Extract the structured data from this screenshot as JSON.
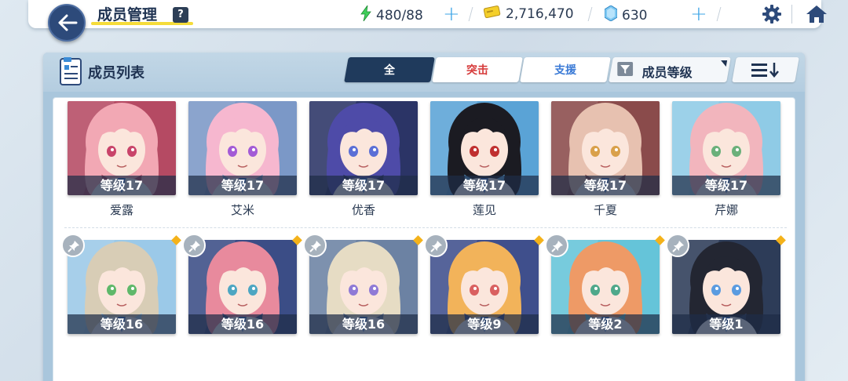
{
  "header": {
    "title": "成员管理",
    "help": "?",
    "stamina": "480/88",
    "credits": "2,716,470",
    "gems": "630"
  },
  "panel": {
    "title": "成员列表",
    "tabs": [
      {
        "label": "全",
        "active": true
      },
      {
        "label": "突击",
        "active": false
      },
      {
        "label": "支援",
        "active": false
      }
    ],
    "sort_label": "成员等级"
  },
  "members_row1": [
    {
      "level": "等级17",
      "name": "爱露",
      "bg": "#b54a63",
      "hair": "#f2a8b4"
    },
    {
      "level": "等级17",
      "name": "艾米",
      "bg": "#7b98c7",
      "hair": "#f6b7cf"
    },
    {
      "level": "等级17",
      "name": "优香",
      "bg": "#2b3466",
      "hair": "#4e4ba8"
    },
    {
      "level": "等级17",
      "name": "莲见",
      "bg": "#5aa3d6",
      "hair": "#1b1b22"
    },
    {
      "level": "等级17",
      "name": "千夏",
      "bg": "#8a4b4b",
      "hair": "#e7c1b0"
    },
    {
      "level": "等级17",
      "name": "芹娜",
      "bg": "#8fcbe6",
      "hair": "#f2b5bd"
    }
  ],
  "members_row2": [
    {
      "level": "等级16",
      "bg": "#9bc9e8",
      "hair": "#d8cdb6"
    },
    {
      "level": "等级16",
      "bg": "#3b4d86",
      "hair": "#e88a9d"
    },
    {
      "level": "等级16",
      "bg": "#6c82a3",
      "hair": "#e6dcc4"
    },
    {
      "level": "等级9",
      "bg": "#3f4f8c",
      "hair": "#f2b35a"
    },
    {
      "level": "等级2",
      "bg": "#65c4d9",
      "hair": "#ee9a66"
    },
    {
      "level": "等级1",
      "bg": "#2d3c58",
      "hair": "#232632"
    }
  ]
}
